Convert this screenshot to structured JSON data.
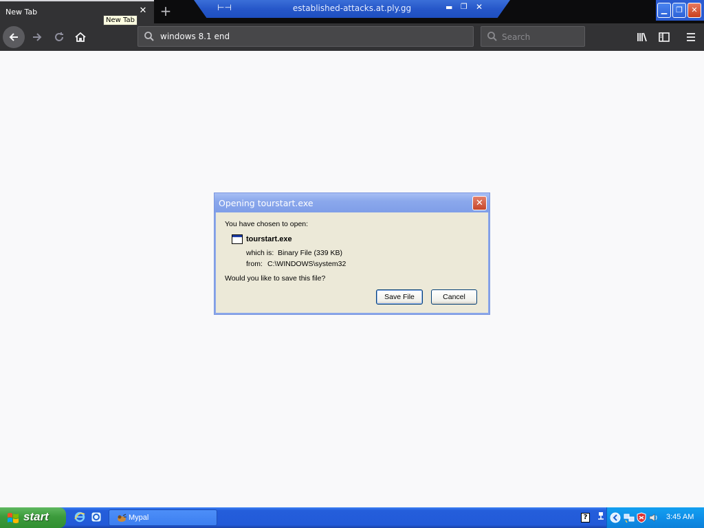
{
  "browser": {
    "tab": {
      "title": "New Tab",
      "tooltip": "New Tab"
    },
    "window_title": "established-attacks.at.ply.gg",
    "urlbar": {
      "value": "windows 8.1 end"
    },
    "searchbar": {
      "placeholder": "Search"
    }
  },
  "dialog": {
    "title": "Opening tourstart.exe",
    "prompt": "You have chosen to open:",
    "file_name": "tourstart.exe",
    "which_is_label": "which is:",
    "which_is_value": "Binary File (339 KB)",
    "from_label": "from:",
    "from_value": "C:\\WINDOWS\\system32",
    "question": "Would you like to save this file?",
    "save_label": "Save File",
    "cancel_label": "Cancel"
  },
  "taskbar": {
    "start_label": "start",
    "task_item_label": "Mypal",
    "clock": "3:45 AM",
    "help_icon_text": "?"
  },
  "colors": {
    "browser_chrome": "#323234",
    "xp_blue": "#245edb",
    "start_green": "#3c9b3c",
    "dialog_bg": "#ece9d8"
  }
}
